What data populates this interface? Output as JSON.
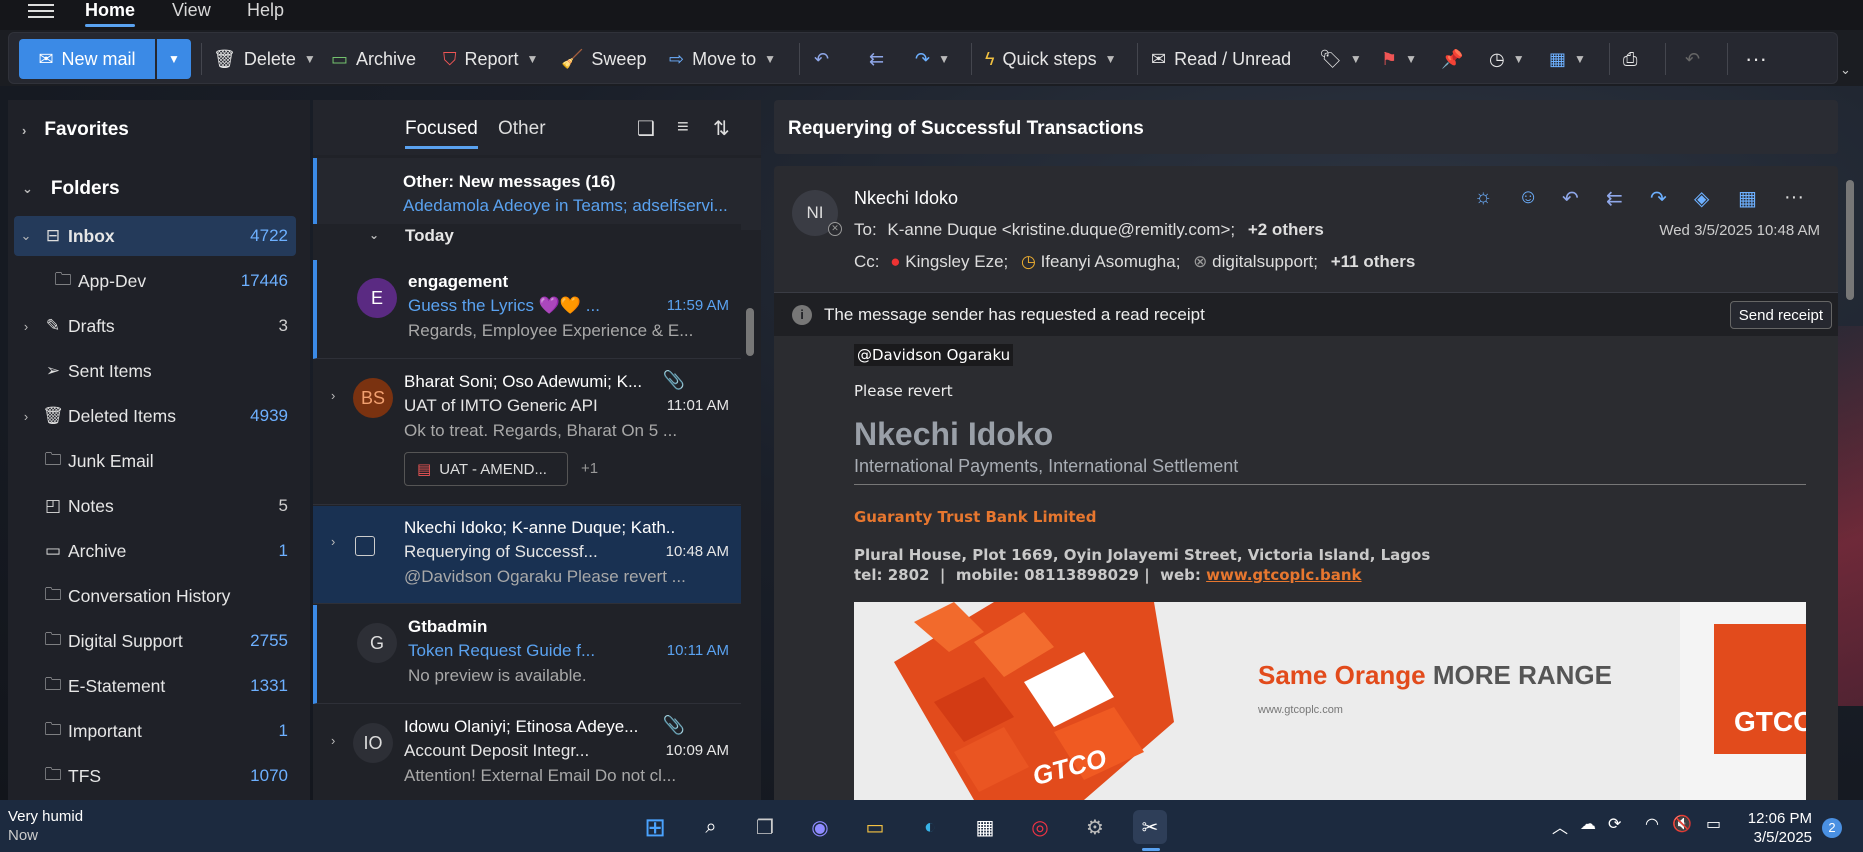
{
  "menu": {
    "tabs": [
      "Home",
      "View",
      "Help"
    ]
  },
  "ribbon": {
    "new_mail": "New mail",
    "delete": "Delete",
    "archive": "Archive",
    "report": "Report",
    "sweep": "Sweep",
    "move_to": "Move to",
    "quick_steps": "Quick steps",
    "read_unread": "Read / Unread"
  },
  "folders": {
    "favorites": "Favorites",
    "folders": "Folders",
    "items": [
      {
        "label": "Inbox",
        "count": "4722"
      },
      {
        "label": "App-Dev",
        "count": "17446"
      },
      {
        "label": "Drafts",
        "count": "3"
      },
      {
        "label": "Sent Items",
        "count": ""
      },
      {
        "label": "Deleted Items",
        "count": "4939"
      },
      {
        "label": "Junk Email",
        "count": ""
      },
      {
        "label": "Notes",
        "count": "5"
      },
      {
        "label": "Archive",
        "count": "1"
      },
      {
        "label": "Conversation History",
        "count": ""
      },
      {
        "label": "Digital Support",
        "count": "2755"
      },
      {
        "label": "E-Statement",
        "count": "1331"
      },
      {
        "label": "Important",
        "count": "1"
      },
      {
        "label": "TFS",
        "count": "1070"
      }
    ]
  },
  "list": {
    "tab_focused": "Focused",
    "tab_other": "Other",
    "other_banner_title": "Other: New messages (16)",
    "other_banner_senders": "Adedamola Adeoye in Teams; adselfservi...",
    "today": "Today",
    "messages": [
      {
        "initials": "E",
        "from": "engagement",
        "subject": "Guess the Lyrics 💜🧡 ...",
        "time": "11:59 AM",
        "preview": "Regards, Employee Experience & E..."
      },
      {
        "initials": "BS",
        "from": "Bharat Soni; Oso Adewumi; K...",
        "subject": "UAT of IMTO Generic API",
        "time": "11:01 AM",
        "preview": "Ok to treat. Regards, Bharat On 5 ...",
        "attachment": "UAT - AMEND...",
        "more": "+1"
      },
      {
        "initials": "",
        "from": "Nkechi Idoko; K-anne Duque; Kath...",
        "subject": "Requerying of Successf...",
        "time": "10:48 AM",
        "preview": "@Davidson Ogaraku Please revert ..."
      },
      {
        "initials": "G",
        "from": "Gtbadmin",
        "subject": "Token Request Guide f...",
        "time": "10:11 AM",
        "preview": "No preview is available."
      },
      {
        "initials": "IO",
        "from": "Idowu Olaniyi; Etinosa Adeye...",
        "subject": "Account Deposit Integr...",
        "time": "10:09 AM",
        "preview": "Attention! External Email Do not cl..."
      }
    ]
  },
  "reading": {
    "subject": "Requerying of Successful Transactions",
    "sender_initials": "NI",
    "sender": "Nkechi Idoko",
    "to_label": "To:",
    "to": "K-anne Duque <kristine.duque@remitly.com>;",
    "to_more": "+2 others",
    "cc_label": "Cc:",
    "cc": [
      "Kingsley Eze;",
      "Ifeanyi Asomugha;",
      "digitalsupport;"
    ],
    "cc_more": "+11 others",
    "date": "Wed 3/5/2025 10:48 AM",
    "receipt_text": "The message sender has requested a read receipt",
    "send_receipt": "Send receipt",
    "mention": "@Davidson Ogaraku",
    "line1": "Please revert",
    "sig_name": "Nkechi Idoko",
    "sig_title": "International Payments, International Settlement",
    "sig_company": "Guaranty Trust Bank Limited",
    "sig_address": "Plural House, Plot 1669, Oyin Jolayemi Street, Victoria Island, Lagos",
    "sig_contacts": "tel: 2802  |  mobile: 08113898029 |  web:",
    "sig_web": "www.gtcoplc.bank",
    "banner_same_orange": "Same Orange",
    "banner_more_range": "MORE RANGE",
    "banner_url": "www.gtcoplc.com",
    "banner_gtco": "GTCO",
    "banner_gtco_right": "GTCO"
  },
  "taskbar": {
    "weather": "Very humid",
    "weather_sub": "Now",
    "time": "12:06 PM",
    "date": "3/5/2025",
    "notif": "2"
  }
}
